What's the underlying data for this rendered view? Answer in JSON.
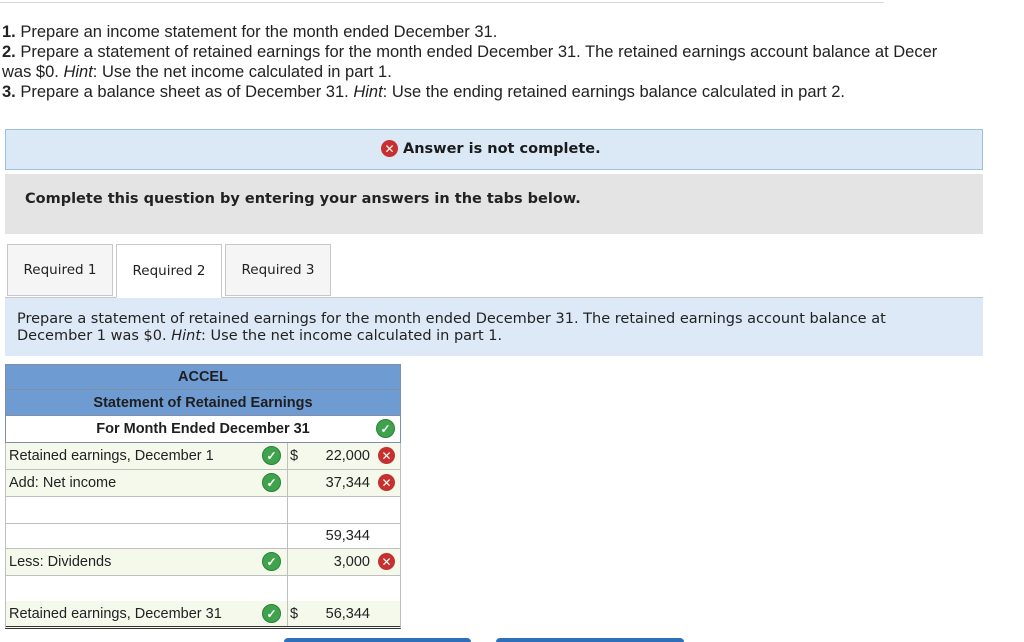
{
  "instructions": [
    {
      "num": "1.",
      "text": " Prepare an income statement for the month ended December 31."
    },
    {
      "num": "2.",
      "text": " Prepare a statement of retained earnings for the month ended December 31. The retained earnings account balance at Decer"
    },
    {
      "num": "",
      "text": "was $0. ",
      "hint": "Hint",
      "after": ": Use the net income calculated in part 1."
    },
    {
      "num": "3.",
      "text": " Prepare a balance sheet as of December 31. ",
      "hint": "Hint",
      "after": ": Use the ending retained earnings balance calculated in part 2."
    }
  ],
  "banner": {
    "text": "Answer is not complete."
  },
  "directions": "Complete this question by entering your answers in the tabs below.",
  "tabs": [
    {
      "label": "Required 1"
    },
    {
      "label": "Required 2"
    },
    {
      "label": "Required 3"
    }
  ],
  "prompt": {
    "line1": "Prepare a statement of retained earnings for the month ended December 31. The retained earnings account balance at",
    "line2a": "December 1 was $0. ",
    "hint": "Hint",
    "line2b": ": Use the net income calculated in part 1."
  },
  "statement": {
    "company": "ACCEL",
    "title": "Statement of Retained Earnings",
    "period": "For Month Ended December 31",
    "rows": [
      {
        "label": "Retained earnings, December 1",
        "dollar": "$",
        "value": "22,000",
        "label_ok": true,
        "value_ok": false
      },
      {
        "label": "Add: Net income",
        "dollar": "",
        "value": "37,344",
        "label_ok": true,
        "value_ok": false
      },
      {
        "label": "",
        "dollar": "",
        "value": ""
      },
      {
        "label": "",
        "dollar": "",
        "value": "59,344"
      },
      {
        "label": "Less: Dividends",
        "dollar": "",
        "value": "3,000",
        "label_ok": true,
        "value_ok": false
      },
      {
        "label": "",
        "dollar": "",
        "value": ""
      },
      {
        "label": "Retained earnings, December 31",
        "dollar": "$",
        "value": "56,344",
        "label_ok": true
      }
    ]
  },
  "colors": {
    "header_bg": "#6f9bd3",
    "banner_bg": "#dbe9f7",
    "error": "#c6302e",
    "ok": "#3fa34d"
  }
}
